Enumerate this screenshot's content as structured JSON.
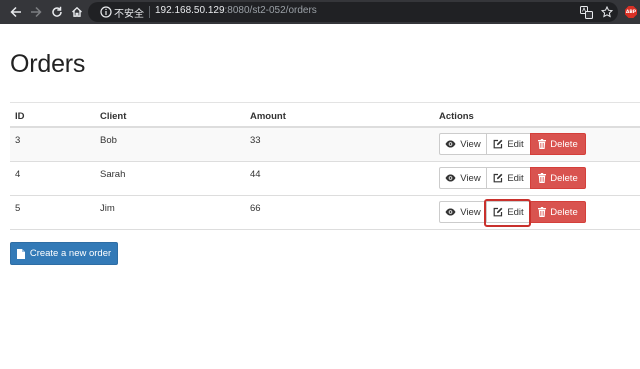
{
  "browser": {
    "status_label": "不安全",
    "url_host": "192.168.50.129",
    "url_rest": ":8080/st2-052/orders",
    "adblock_label": "ABP"
  },
  "page": {
    "title": "Orders"
  },
  "table": {
    "headers": {
      "id": "ID",
      "client": "Client",
      "amount": "Amount",
      "actions": "Actions"
    },
    "rows": [
      {
        "id": "3",
        "client": "Bob",
        "amount": "33"
      },
      {
        "id": "4",
        "client": "Sarah",
        "amount": "44"
      },
      {
        "id": "5",
        "client": "Jim",
        "amount": "66"
      }
    ],
    "actions": {
      "view_label": "View",
      "edit_label": "Edit",
      "delete_label": "Delete"
    }
  },
  "create_button": {
    "label": "Create a new order"
  },
  "colors": {
    "delete": "#d9534f",
    "primary": "#337ab7",
    "highlight": "#c9302c",
    "chrome": "#35363a"
  },
  "icons": {
    "view": "eye-icon",
    "edit": "edit-icon",
    "delete": "trash-icon",
    "create": "file-icon"
  }
}
